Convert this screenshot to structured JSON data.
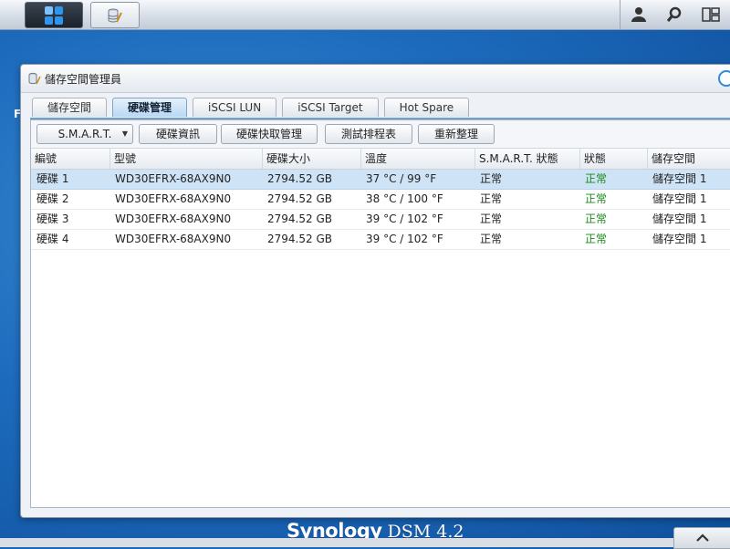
{
  "window": {
    "title": "儲存空間管理員"
  },
  "tabs": [
    {
      "label": "儲存空間",
      "active": false
    },
    {
      "label": "硬碟管理",
      "active": true
    },
    {
      "label": "iSCSI LUN",
      "active": false
    },
    {
      "label": "iSCSI Target",
      "active": false
    },
    {
      "label": "Hot Spare",
      "active": false
    }
  ],
  "toolbar": {
    "smart_label": "S.M.A.R.T.",
    "disk_info_label": "硬碟資訊",
    "cache_label": "硬碟快取管理",
    "test_schedule_label": "測試排程表",
    "reorganize_label": "重新整理"
  },
  "table": {
    "columns": [
      "編號",
      "型號",
      "硬碟大小",
      "溫度",
      "S.M.A.R.T. 狀態",
      "狀態",
      "儲存空間"
    ],
    "rows": [
      [
        "硬碟 1",
        "WD30EFRX-68AX9N0",
        "2794.52 GB",
        "37 °C / 99 °F",
        "正常",
        "正常",
        "儲存空間 1"
      ],
      [
        "硬碟 2",
        "WD30EFRX-68AX9N0",
        "2794.52 GB",
        "38 °C / 100 °F",
        "正常",
        "正常",
        "儲存空間 1"
      ],
      [
        "硬碟 3",
        "WD30EFRX-68AX9N0",
        "2794.52 GB",
        "39 °C / 102 °F",
        "正常",
        "正常",
        "儲存空間 1"
      ],
      [
        "硬碟 4",
        "WD30EFRX-68AX9N0",
        "2794.52 GB",
        "39 °C / 102 °F",
        "正常",
        "正常",
        "儲存空間 1"
      ]
    ],
    "selected_row": 0
  },
  "desktop": {
    "side_letter": "F"
  },
  "brand": {
    "name": "Synology",
    "version": "DSM 4.2"
  },
  "colors": {
    "status_ok": "#1a8a1a",
    "selected_row": "#cfe3f6",
    "accent": "#2f95ef"
  },
  "icons": {
    "main_menu": "grid-icon",
    "storage_app": "database-wrench-icon",
    "user": "user-icon",
    "search": "search-icon",
    "widgets": "widgets-icon",
    "collapse": "chevron-up-icon"
  }
}
